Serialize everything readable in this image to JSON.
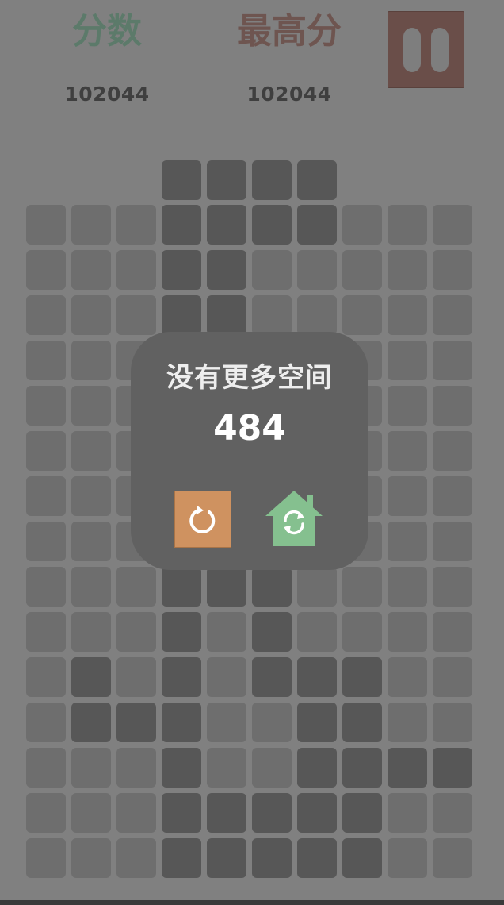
{
  "header": {
    "score_label": "分数",
    "best_label": "最高分",
    "score_value": "102044",
    "best_value": "102044"
  },
  "pause_button": {
    "icon": "pause-icon",
    "color": "#6a4e49"
  },
  "board": {
    "columns": 10,
    "rows": 15,
    "colors": {
      "empty": "#6e6e6e",
      "filled": "#575757",
      "background": "#808080"
    },
    "filled_cells": [
      [
        3,
        0
      ],
      [
        4,
        0
      ],
      [
        5,
        0
      ],
      [
        6,
        0
      ],
      [
        3,
        1
      ],
      [
        4,
        1
      ],
      [
        5,
        1
      ],
      [
        6,
        1
      ],
      [
        3,
        2
      ],
      [
        4,
        2
      ],
      [
        3,
        3
      ],
      [
        4,
        3
      ],
      [
        3,
        9
      ],
      [
        4,
        9
      ],
      [
        5,
        9
      ],
      [
        3,
        10
      ],
      [
        5,
        10
      ],
      [
        1,
        11
      ],
      [
        3,
        11
      ],
      [
        5,
        11
      ],
      [
        6,
        11
      ],
      [
        7,
        11
      ],
      [
        1,
        12
      ],
      [
        2,
        12
      ],
      [
        3,
        12
      ],
      [
        6,
        12
      ],
      [
        7,
        12
      ],
      [
        3,
        13
      ],
      [
        6,
        13
      ],
      [
        7,
        13
      ],
      [
        8,
        13
      ],
      [
        9,
        13
      ],
      [
        3,
        14
      ],
      [
        4,
        14
      ],
      [
        5,
        14
      ],
      [
        6,
        14
      ],
      [
        7,
        14
      ],
      [
        3,
        15
      ],
      [
        4,
        15
      ],
      [
        5,
        15
      ],
      [
        6,
        15
      ],
      [
        7,
        15
      ]
    ]
  },
  "dialog": {
    "title": "没有更多空间",
    "score": "484",
    "restart_icon": "restart-icon",
    "home_icon": "home-refresh-icon",
    "colors": {
      "background": "#616161",
      "restart": "#cf9260",
      "home": "#85c08f"
    }
  }
}
